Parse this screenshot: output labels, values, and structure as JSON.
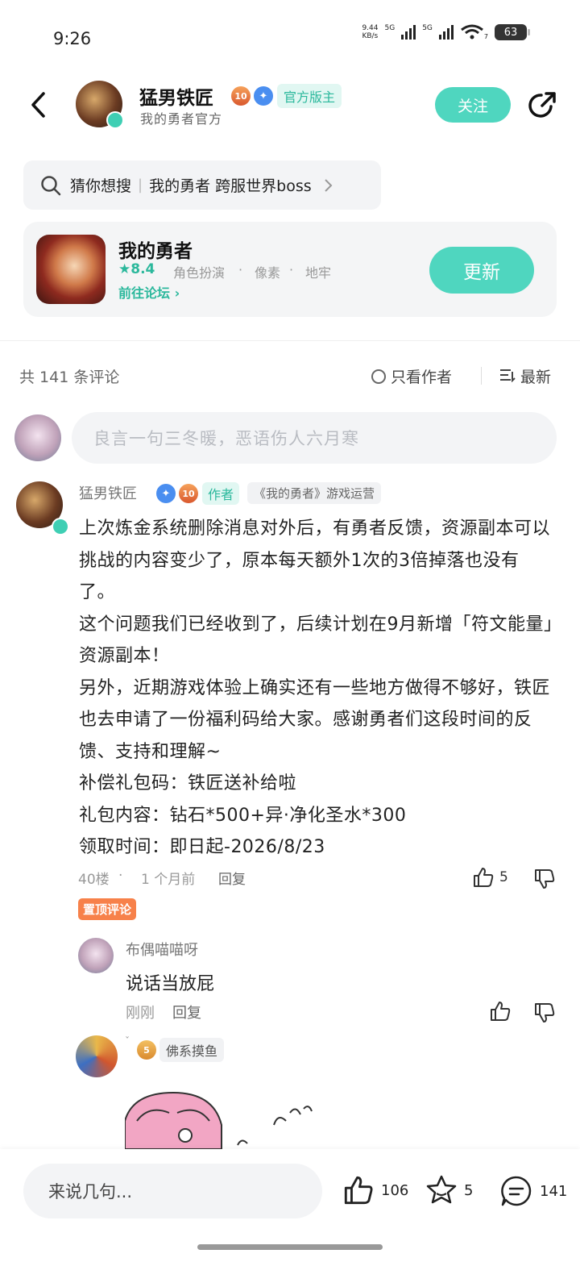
{
  "status_bar": {
    "time": "9:26",
    "net_speed": "9.44",
    "net_unit": "KB/s",
    "sig1": "5G",
    "sig2": "5G",
    "wifi_num": "7",
    "battery": "63"
  },
  "header": {
    "name": "猛男铁匠",
    "level": "10",
    "role_tag": "官方版主",
    "subtitle": "我的勇者官方",
    "follow_label": "关注"
  },
  "search": {
    "hint_prefix": "猜你想搜",
    "query": "我的勇者 跨服世界boss"
  },
  "game": {
    "title": "我的勇者",
    "rating": "8.4",
    "tags": [
      "角色扮演",
      "像素",
      "地牢"
    ],
    "forum_link": "前往论坛",
    "update_label": "更新"
  },
  "comments": {
    "count_text": "共 141 条评论",
    "author_only": "只看作者",
    "sort": "最新",
    "input_placeholder": "良言一句三冬暖，恶语伤人六月寒"
  },
  "main_comment": {
    "author": "猛男铁匠",
    "level": "10",
    "author_tag": "作者",
    "role_tag": "《我的勇者》游戏运营",
    "body": "上次炼金系统删除消息对外后，有勇者反馈，资源副本可以挑战的内容变少了，原本每天额外1次的3倍掉落也没有了。\n这个问题我们已经收到了，后续计划在9月新增「符文能量」资源副本！\n另外，近期游戏体验上确实还有一些地方做得不够好，铁匠也去申请了一份福利码给大家。感谢勇者们这段时间的反馈、支持和理解~\n补偿礼包码：铁匠送补给啦\n礼包内容：钻石*500+异·净化圣水*300\n领取时间：即日起-2026/8/23",
    "floor": "40楼",
    "time": "1 个月前",
    "reply_label": "回复",
    "likes": "5",
    "pinned_label": "置顶评论"
  },
  "reply1": {
    "author": "布偶喵喵呀",
    "body": "说话当放屁",
    "time": "刚刚",
    "reply_label": "回复"
  },
  "reply2": {
    "level": "5",
    "tag": "佛系摸鱼"
  },
  "bottom_bar": {
    "input_placeholder": "来说几句...",
    "likes": "106",
    "favorites": "5",
    "comments": "141"
  }
}
